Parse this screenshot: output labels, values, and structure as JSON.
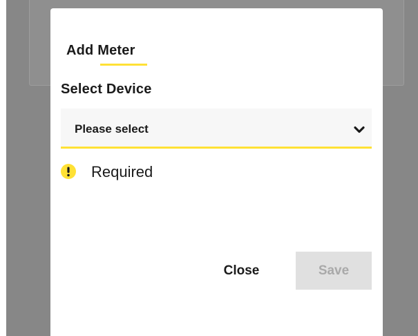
{
  "dialog": {
    "tab_label": "Add Meter",
    "section_label": "Select Device",
    "select": {
      "value": "Please select",
      "icon": "chevron-down-icon"
    },
    "validation": {
      "icon": "warning-icon",
      "message": "Required"
    },
    "buttons": {
      "close_label": "Close",
      "save_label": "Save",
      "save_disabled": true
    }
  },
  "colors": {
    "accent": "#ffe135",
    "backdrop": "#878787",
    "field_background": "#f7f7f7",
    "disabled_button": "#e0e0e0",
    "disabled_text": "#a9a9a9",
    "text": "#1a1a1a"
  }
}
